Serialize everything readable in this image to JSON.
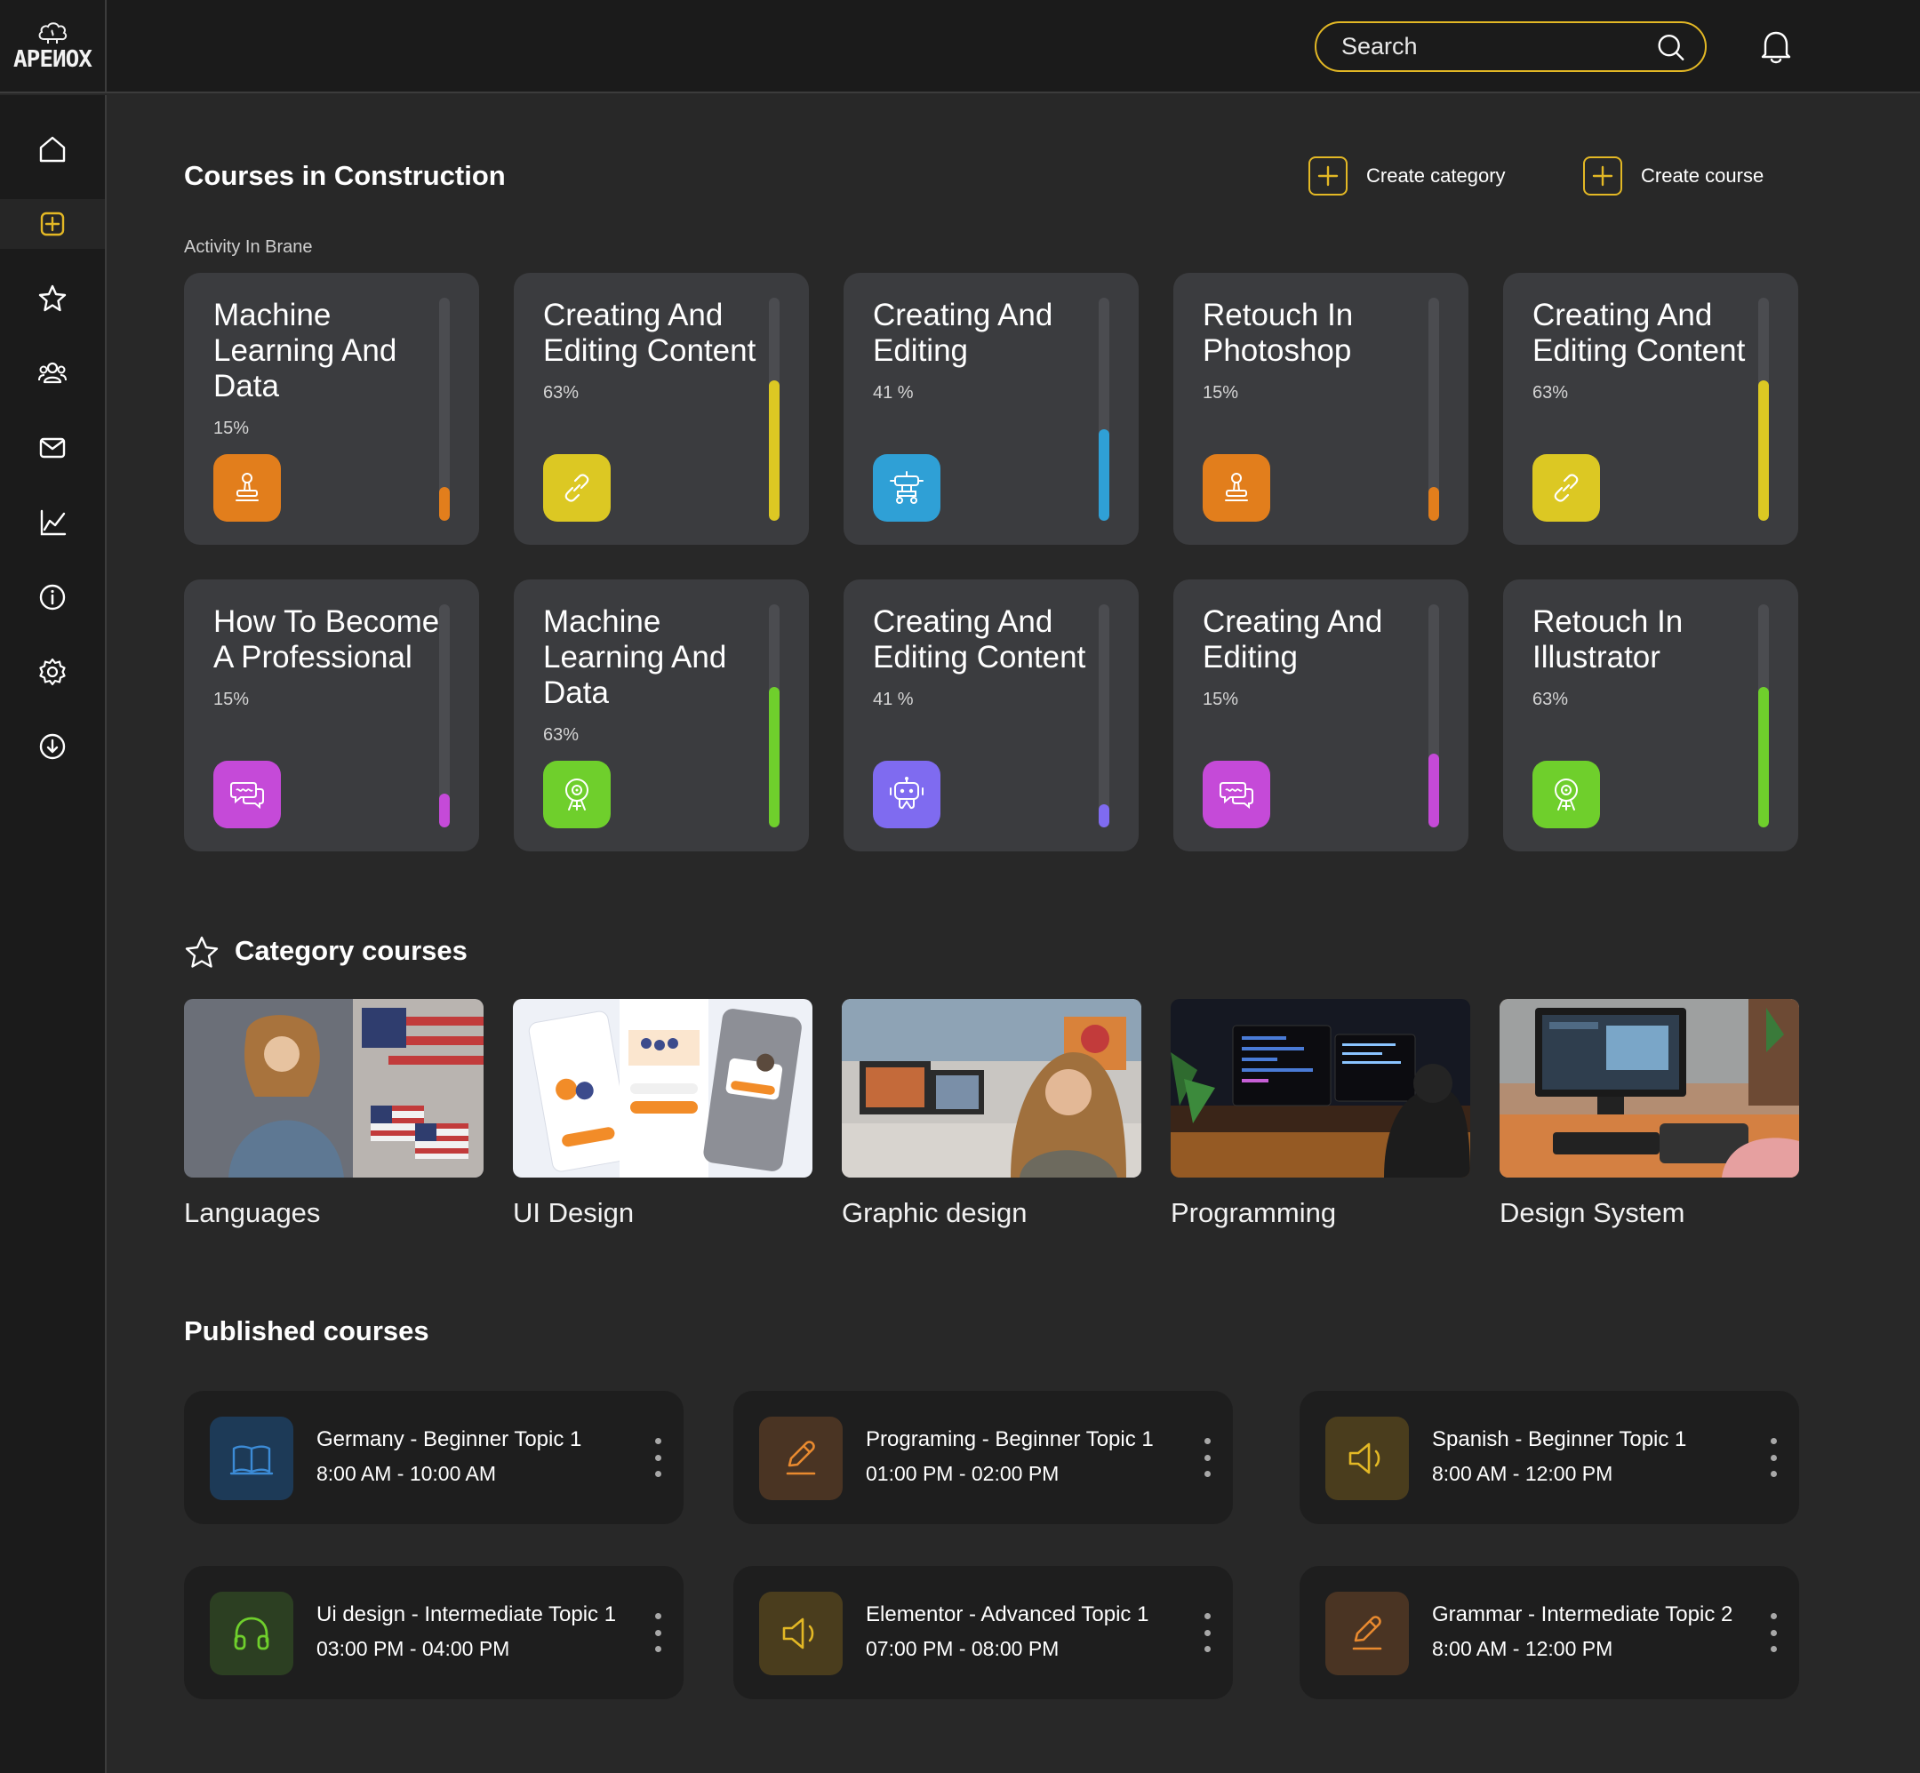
{
  "app": {
    "logo_text": "APEИOX"
  },
  "search": {
    "placeholder": "Search"
  },
  "sidebar": {
    "items": [
      {
        "name": "home",
        "icon": "home-icon",
        "active": false
      },
      {
        "name": "create",
        "icon": "plus-square-icon",
        "active": true
      },
      {
        "name": "favorites",
        "icon": "star-icon",
        "active": false
      },
      {
        "name": "users",
        "icon": "users-icon",
        "active": false
      },
      {
        "name": "messages",
        "icon": "mail-icon",
        "active": false
      },
      {
        "name": "analytics",
        "icon": "chart-icon",
        "active": false
      },
      {
        "name": "info",
        "icon": "info-icon",
        "active": false
      },
      {
        "name": "settings",
        "icon": "gear-icon",
        "active": false
      },
      {
        "name": "download",
        "icon": "download-icon",
        "active": false
      }
    ]
  },
  "construction": {
    "title": "Courses in Construction",
    "subtitle": "Activity In Brane",
    "create_category": "Create category",
    "create_course": "Create course",
    "courses": [
      {
        "title": "Machine Learning And Data",
        "percent": "15%",
        "progress": 0.15,
        "color": "#e27e1c",
        "icon": "stamp-icon"
      },
      {
        "title": "Creating And Editing Content",
        "percent": "63%",
        "progress": 0.63,
        "color": "#dcc823",
        "icon": "link-icon"
      },
      {
        "title": "Creating And Editing",
        "percent": "41 %",
        "progress": 0.41,
        "color": "#2fa0d6",
        "icon": "robot-icon"
      },
      {
        "title": "Retouch In Photoshop",
        "percent": "15%",
        "progress": 0.15,
        "color": "#e27e1c",
        "icon": "stamp-icon"
      },
      {
        "title": "Creating And Editing Content",
        "percent": "63%",
        "progress": 0.63,
        "color": "#dcc823",
        "icon": "link-icon"
      },
      {
        "title": "How To Become A Professional",
        "percent": "15%",
        "progress": 0.15,
        "color": "#c54ad8",
        "icon": "chat-icon"
      },
      {
        "title": "Machine Learning And Data",
        "percent": "63%",
        "progress": 0.63,
        "color": "#6fcf2c",
        "icon": "webcam-icon"
      },
      {
        "title": "Creating And Editing Content",
        "percent": "41 %",
        "progress": 0.1,
        "color": "#7f6bf0",
        "icon": "bot-icon"
      },
      {
        "title": "Creating And Editing",
        "percent": "15%",
        "progress": 0.33,
        "color": "#c54ad8",
        "icon": "chat-icon"
      },
      {
        "title": "Retouch In Illustrator",
        "percent": "63%",
        "progress": 0.63,
        "color": "#6fcf2c",
        "icon": "webcam-icon"
      }
    ]
  },
  "categories": {
    "title": "Category courses",
    "items": [
      {
        "label": "Languages",
        "image": "woman-with-flags-photo"
      },
      {
        "label": "UI Design",
        "image": "app-mockup-screens"
      },
      {
        "label": "Graphic design",
        "image": "woman-at-computer-photo"
      },
      {
        "label": "Programming",
        "image": "programmer-desk-photo"
      },
      {
        "label": "Design System",
        "image": "designer-tablet-photo"
      }
    ]
  },
  "published": {
    "title": "Published courses",
    "items": [
      {
        "title": "Germany - Beginner Topic 1",
        "time": "8:00 AM - 10:00 AM",
        "icon": "book-icon",
        "bg": "#1d3a57",
        "fg": "#3c8bd6"
      },
      {
        "title": "Programing - Beginner Topic 1",
        "time": "01:00 PM - 02:00 PM",
        "icon": "pencil-icon",
        "bg": "#4a3423",
        "fg": "#e98a2f"
      },
      {
        "title": "Spanish - Beginner Topic 1",
        "time": "8:00 AM - 12:00 PM",
        "icon": "speaker-icon",
        "bg": "#4a3d1d",
        "fg": "#e3b825"
      },
      {
        "title": "Ui design - Intermediate Topic 1",
        "time": "03:00 PM - 04:00 PM",
        "icon": "headphones-icon",
        "bg": "#2c3f22",
        "fg": "#6fcf2c"
      },
      {
        "title": "Elementor - Advanced Topic 1",
        "time": "07:00 PM - 08:00 PM",
        "icon": "speaker-icon",
        "bg": "#4a3d1d",
        "fg": "#e3b825"
      },
      {
        "title": "Grammar - Intermediate Topic 2",
        "time": "8:00 AM - 12:00 PM",
        "icon": "pencil-icon",
        "bg": "#4a3423",
        "fg": "#e98a2f"
      }
    ]
  },
  "colors": {
    "accent": "#e3b825",
    "background": "#282828",
    "chrome": "#1b1b1b",
    "card": "#3b3c3f"
  }
}
